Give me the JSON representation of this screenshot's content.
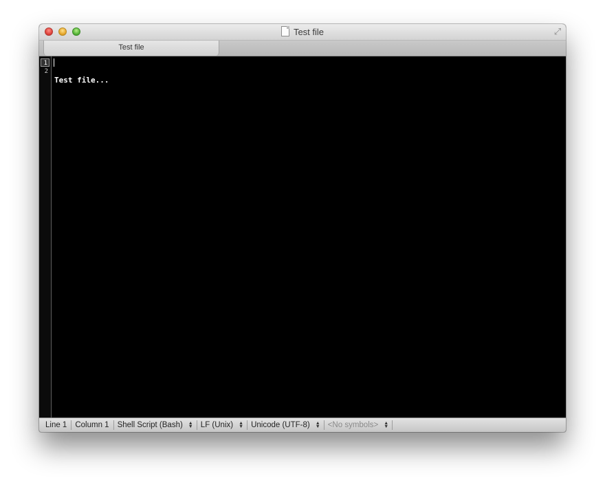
{
  "window": {
    "title": "Test file"
  },
  "tabs": [
    {
      "label": "Test file"
    }
  ],
  "editor": {
    "line_numbers": [
      "1",
      "2"
    ],
    "lines": [
      "Test file...",
      ""
    ]
  },
  "statusbar": {
    "line": "Line 1",
    "column": "Column 1",
    "syntax": "Shell Script (Bash)",
    "line_endings": "LF (Unix)",
    "encoding": "Unicode (UTF-8)",
    "symbols": "<No symbols>"
  },
  "icons": {
    "close": "close-button",
    "minimize": "minimize-button",
    "zoom": "zoom-button",
    "document": "document-icon",
    "fullscreen": "fullscreen-icon",
    "popup_arrows": "updown-arrows-icon"
  },
  "colors": {
    "editor_background": "#000000",
    "text": "#ffffff",
    "close": "#e0443e",
    "minimize": "#e7a92f",
    "zoom": "#58b53a"
  }
}
